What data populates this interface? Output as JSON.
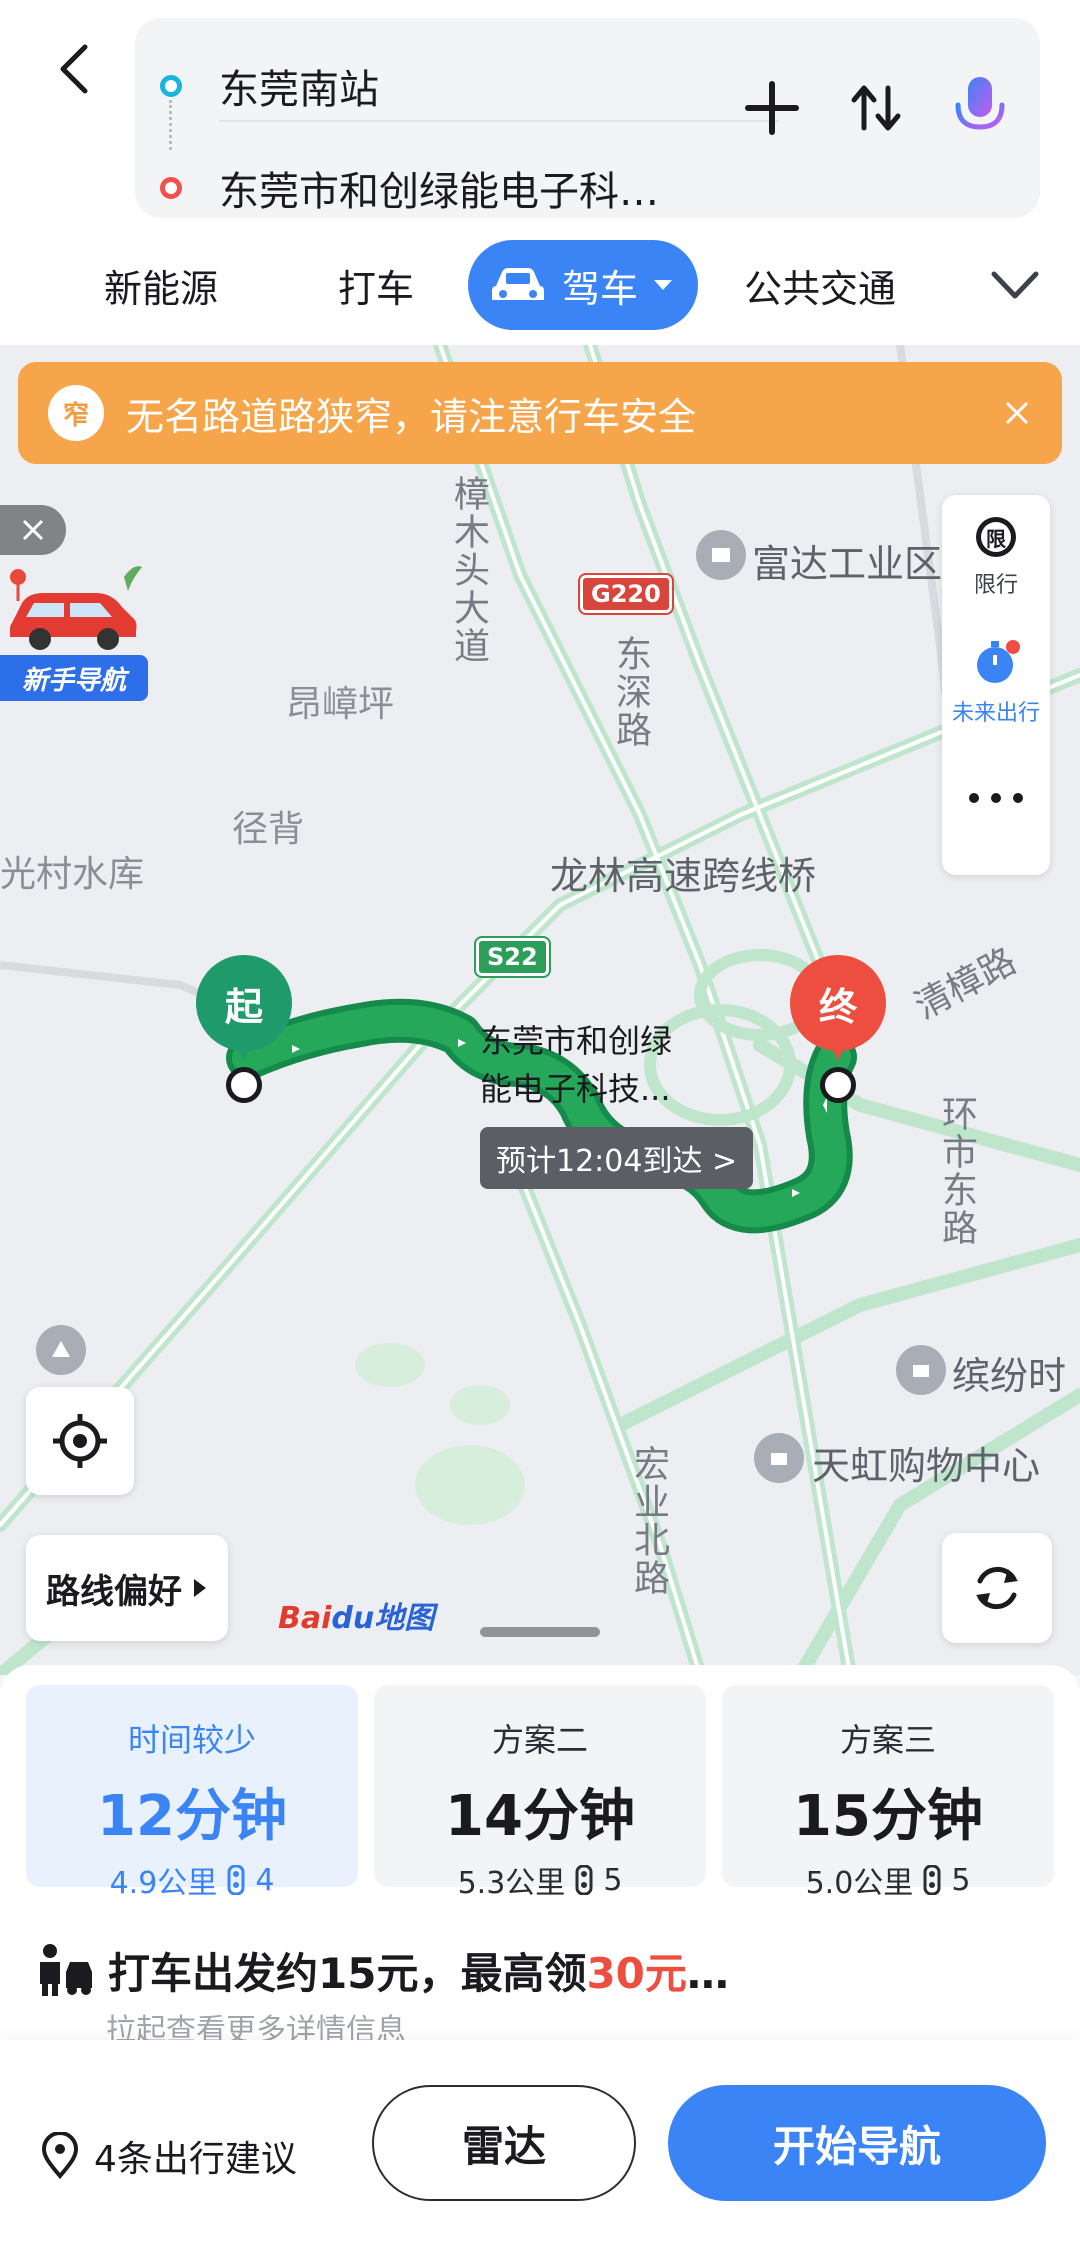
{
  "route": {
    "origin": "东莞南站",
    "destination": "东莞市和创绿能电子科…"
  },
  "modes": {
    "items": [
      "新能源",
      "打车",
      "驾车",
      "公共交通"
    ],
    "active": "驾车"
  },
  "alert": {
    "icon_char": "窄",
    "text": "无名路道路狭窄，请注意行车安全"
  },
  "novice": {
    "label": "新手导航"
  },
  "side_panel": {
    "restrict_icon_char": "限",
    "restrict_label": "限行",
    "future_label": "未来出行"
  },
  "map": {
    "places": [
      {
        "id": "fuda",
        "text": "富达工业区"
      },
      {
        "id": "angzhangping",
        "text": "昂嶂坪"
      },
      {
        "id": "jingbei",
        "text": "径背"
      },
      {
        "id": "guangcun",
        "text": "光村水库"
      },
      {
        "id": "longlin",
        "text": "龙林高速跨线桥"
      },
      {
        "id": "binfen",
        "text": "缤纷时"
      },
      {
        "id": "tianhong",
        "text": "天虹购物中心"
      }
    ],
    "roads": {
      "zhangmutou": "樟木头大道",
      "dongshen": "东深路",
      "qingzhang": "清樟路",
      "huanshi": "环市东路",
      "hongye": "宏业北路"
    },
    "shields": {
      "g220": "G220",
      "s22": "S22"
    },
    "start_marker": "起",
    "end_marker": "终",
    "dest_label_line1": "东莞市和创绿",
    "dest_label_line2": "能电子科技...",
    "eta": "预计12:04到达 >",
    "route_pref": "路线偏好",
    "logo_bai": "Bai",
    "logo_du": "du地图"
  },
  "plans": [
    {
      "name": "时间较少",
      "time": "12分钟",
      "distance": "4.9公里",
      "lights": "4",
      "active": true
    },
    {
      "name": "方案二",
      "time": "14分钟",
      "distance": "5.3公里",
      "lights": "5",
      "active": false
    },
    {
      "name": "方案三",
      "time": "15分钟",
      "distance": "5.0公里",
      "lights": "5",
      "active": false
    }
  ],
  "taxi": {
    "text_prefix": "打车出发约15元，最高领",
    "highlight": "30元",
    "text_suffix": "…",
    "sub": "拉起查看更多详情信息"
  },
  "actions": {
    "suggest": "4条出行建议",
    "radar": "雷达",
    "start_nav": "开始导航"
  },
  "colors": {
    "accent": "#3a84f6",
    "route_green": "#25a85a",
    "alert_orange": "#f6a54b",
    "highlight_red": "#ee4e40"
  }
}
